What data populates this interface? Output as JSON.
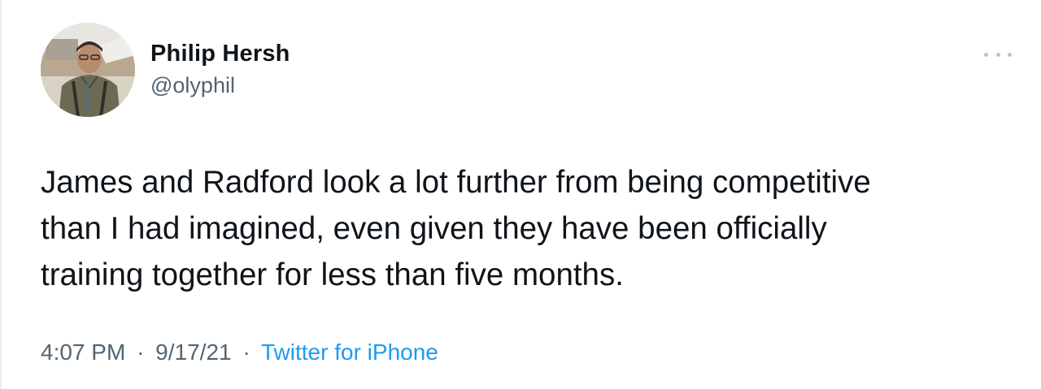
{
  "author": {
    "name": "Philip Hersh",
    "handle": "@olyphil"
  },
  "tweet": {
    "lines": [
      "James and Radford look a lot further from being competitive",
      "than I had imagined, even given they have been officially",
      "training together for less than five months."
    ]
  },
  "meta": {
    "time": "4:07 PM",
    "date": "9/17/21",
    "separator": "·",
    "source": "Twitter for iPhone"
  },
  "icons": {
    "more": "more-horizontal-icon",
    "avatar": "avatar-photo"
  },
  "colors": {
    "text_primary": "#0f1419",
    "text_secondary": "#536471",
    "link": "#1d9bf0"
  }
}
